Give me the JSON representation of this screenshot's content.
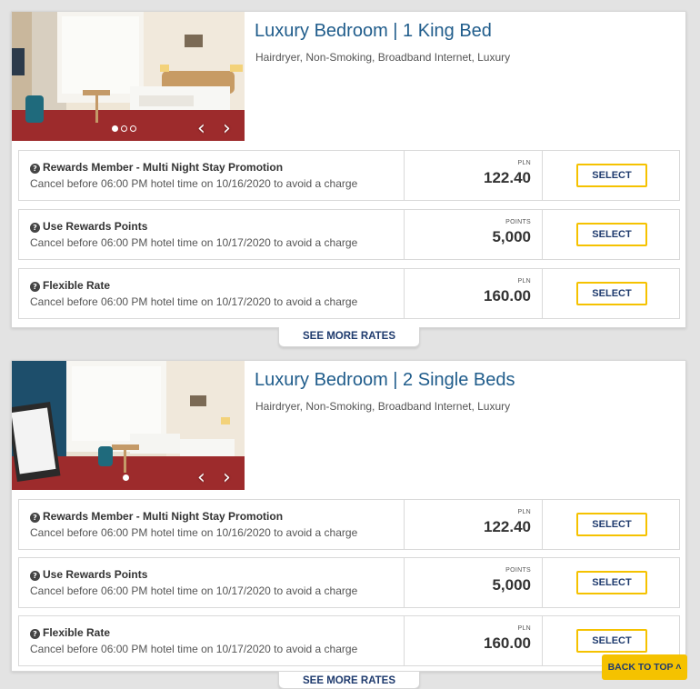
{
  "rooms": [
    {
      "title": "Luxury Bedroom | 1 King Bed",
      "amenities": "Hairdryer, Non-Smoking, Broadband Internet, Luxury",
      "rates": [
        {
          "name": "Rewards Member - Multi Night Stay Promotion",
          "cancel": "Cancel before 06:00 PM hotel time on 10/16/2020 to avoid a charge",
          "currency": "PLN",
          "price": "122.40",
          "select_label": "SELECT"
        },
        {
          "name": "Use Rewards Points",
          "cancel": "Cancel before 06:00 PM hotel time on 10/17/2020 to avoid a charge",
          "currency": "POINTS",
          "price": "5,000",
          "select_label": "SELECT"
        },
        {
          "name": "Flexible Rate",
          "cancel": "Cancel before 06:00 PM hotel time on 10/17/2020 to avoid a charge",
          "currency": "PLN",
          "price": "160.00",
          "select_label": "SELECT"
        }
      ],
      "see_more_label": "SEE MORE RATES"
    },
    {
      "title": "Luxury Bedroom | 2 Single Beds",
      "amenities": "Hairdryer, Non-Smoking, Broadband Internet, Luxury",
      "rates": [
        {
          "name": "Rewards Member - Multi Night Stay Promotion",
          "cancel": "Cancel before 06:00 PM hotel time on 10/16/2020 to avoid a charge",
          "currency": "PLN",
          "price": "122.40",
          "select_label": "SELECT"
        },
        {
          "name": "Use Rewards Points",
          "cancel": "Cancel before 06:00 PM hotel time on 10/17/2020 to avoid a charge",
          "currency": "POINTS",
          "price": "5,000",
          "select_label": "SELECT"
        },
        {
          "name": "Flexible Rate",
          "cancel": "Cancel before 06:00 PM hotel time on 10/17/2020 to avoid a charge",
          "currency": "PLN",
          "price": "160.00",
          "select_label": "SELECT"
        }
      ],
      "see_more_label": "SEE MORE RATES"
    }
  ],
  "back_to_top_label": "BACK TO TOP ˄",
  "icons": {
    "help": "question-circle-icon",
    "prev": "chevron-left-icon",
    "next": "chevron-right-icon"
  },
  "colors": {
    "title_blue": "#1f5c8b",
    "accent_yellow": "#f5c200",
    "button_text": "#1f3b6e"
  }
}
